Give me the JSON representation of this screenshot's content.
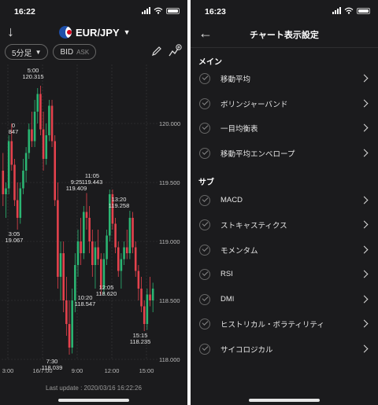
{
  "left": {
    "status": {
      "time": "16:22"
    },
    "header": {
      "pair": "EUR/JPY"
    },
    "toolbar": {
      "timeframe": "5分足",
      "price_type": "BID",
      "price_sub": "ASK"
    },
    "footer": "Last update : 2020/03/16 16:22:26"
  },
  "right": {
    "status": {
      "time": "16:23"
    },
    "title": "チャート表示設定",
    "sections": [
      {
        "label": "メイン",
        "items": [
          "移動平均",
          "ボリンジャーバンド",
          "一目均衡表",
          "移動平均エンベロープ"
        ]
      },
      {
        "label": "サブ",
        "items": [
          "MACD",
          "ストキャスティクス",
          "モメンタム",
          "RSI",
          "DMI",
          "ヒストリカル・ボラティリティ",
          "サイコロジカル"
        ]
      }
    ]
  },
  "chart_data": {
    "type": "candlestick",
    "symbol": "EUR/JPY",
    "y_ticks": [
      "120.000",
      "119.500",
      "119.000",
      "118.500",
      "118.000"
    ],
    "ylim": [
      118.0,
      120.5
    ],
    "x_ticks": [
      "3:00",
      "16/7:00",
      "9:00",
      "12:00",
      "15:00"
    ],
    "annotations": [
      {
        "label": "0",
        "price": "847"
      },
      {
        "label": "5:00",
        "price": "120.315"
      },
      {
        "label": "3:05",
        "price": "19.067"
      },
      {
        "label": "9:25",
        "price": "119.409"
      },
      {
        "label": "11:05",
        "price": "119.443"
      },
      {
        "label": "13:20",
        "price": "119.258"
      },
      {
        "label": "10:20",
        "price": "118.547"
      },
      {
        "label": "12:05",
        "price": "118.620"
      },
      {
        "label": "15:15",
        "price": "118.235"
      },
      {
        "label": "7:30",
        "price": "118.039"
      }
    ],
    "colors": {
      "up": "#2bb673",
      "down": "#e5424d",
      "grid": "#3a3a3c"
    },
    "candles": [
      [
        119.6,
        119.75,
        119.3,
        119.4
      ],
      [
        119.4,
        119.5,
        119.2,
        119.45
      ],
      [
        119.45,
        119.9,
        119.4,
        119.85
      ],
      [
        119.85,
        120.0,
        119.6,
        119.65
      ],
      [
        119.65,
        119.7,
        119.3,
        119.35
      ],
      [
        119.35,
        119.5,
        119.1,
        119.2
      ],
      [
        119.2,
        119.5,
        119.15,
        119.45
      ],
      [
        119.45,
        119.7,
        119.4,
        119.6
      ],
      [
        119.6,
        119.8,
        119.5,
        119.75
      ],
      [
        119.75,
        120.0,
        119.7,
        119.95
      ],
      [
        119.95,
        120.1,
        119.8,
        119.85
      ],
      [
        119.85,
        120.2,
        119.8,
        120.1
      ],
      [
        120.1,
        120.3,
        120.0,
        120.25
      ],
      [
        120.25,
        120.32,
        119.9,
        119.95
      ],
      [
        119.95,
        120.1,
        119.6,
        119.7
      ],
      [
        119.7,
        120.0,
        119.65,
        119.9
      ],
      [
        119.9,
        120.2,
        119.85,
        120.15
      ],
      [
        120.15,
        120.2,
        119.8,
        119.85
      ],
      [
        119.85,
        119.9,
        119.3,
        119.35
      ],
      [
        119.35,
        119.5,
        118.6,
        118.7
      ],
      [
        118.7,
        119.0,
        118.5,
        118.9
      ],
      [
        118.9,
        119.0,
        118.4,
        118.5
      ],
      [
        118.5,
        118.7,
        118.2,
        118.3
      ],
      [
        118.3,
        118.5,
        118.04,
        118.1
      ],
      [
        118.1,
        118.6,
        118.05,
        118.5
      ],
      [
        118.5,
        118.9,
        118.4,
        118.8
      ],
      [
        118.8,
        119.1,
        118.7,
        119.0
      ],
      [
        119.0,
        119.2,
        118.8,
        118.9
      ],
      [
        118.9,
        119.3,
        118.85,
        119.25
      ],
      [
        119.25,
        119.41,
        119.1,
        119.2
      ],
      [
        119.2,
        119.3,
        118.9,
        119.0
      ],
      [
        119.0,
        119.1,
        118.7,
        118.8
      ],
      [
        118.8,
        119.0,
        118.6,
        118.95
      ],
      [
        118.95,
        119.1,
        118.8,
        118.85
      ],
      [
        118.85,
        118.9,
        118.55,
        118.6
      ],
      [
        118.6,
        118.9,
        118.55,
        118.85
      ],
      [
        118.85,
        119.1,
        118.8,
        119.05
      ],
      [
        119.05,
        119.44,
        119.0,
        119.4
      ],
      [
        119.4,
        119.44,
        119.1,
        119.15
      ],
      [
        119.15,
        119.2,
        118.9,
        118.95
      ],
      [
        118.95,
        119.0,
        118.7,
        118.75
      ],
      [
        118.75,
        118.9,
        118.6,
        118.85
      ],
      [
        118.85,
        119.0,
        118.8,
        118.95
      ],
      [
        118.95,
        119.1,
        118.85,
        118.9
      ],
      [
        118.9,
        119.26,
        118.85,
        119.2
      ],
      [
        119.2,
        119.25,
        118.9,
        118.95
      ],
      [
        118.95,
        119.0,
        118.7,
        118.75
      ],
      [
        118.75,
        118.8,
        118.5,
        118.6
      ],
      [
        118.6,
        118.7,
        118.4,
        118.45
      ],
      [
        118.45,
        118.5,
        118.24,
        118.3
      ],
      [
        118.3,
        118.6,
        118.25,
        118.55
      ],
      [
        118.55,
        118.7,
        118.45,
        118.5
      ],
      [
        118.5,
        118.65,
        118.4,
        118.6
      ]
    ]
  }
}
